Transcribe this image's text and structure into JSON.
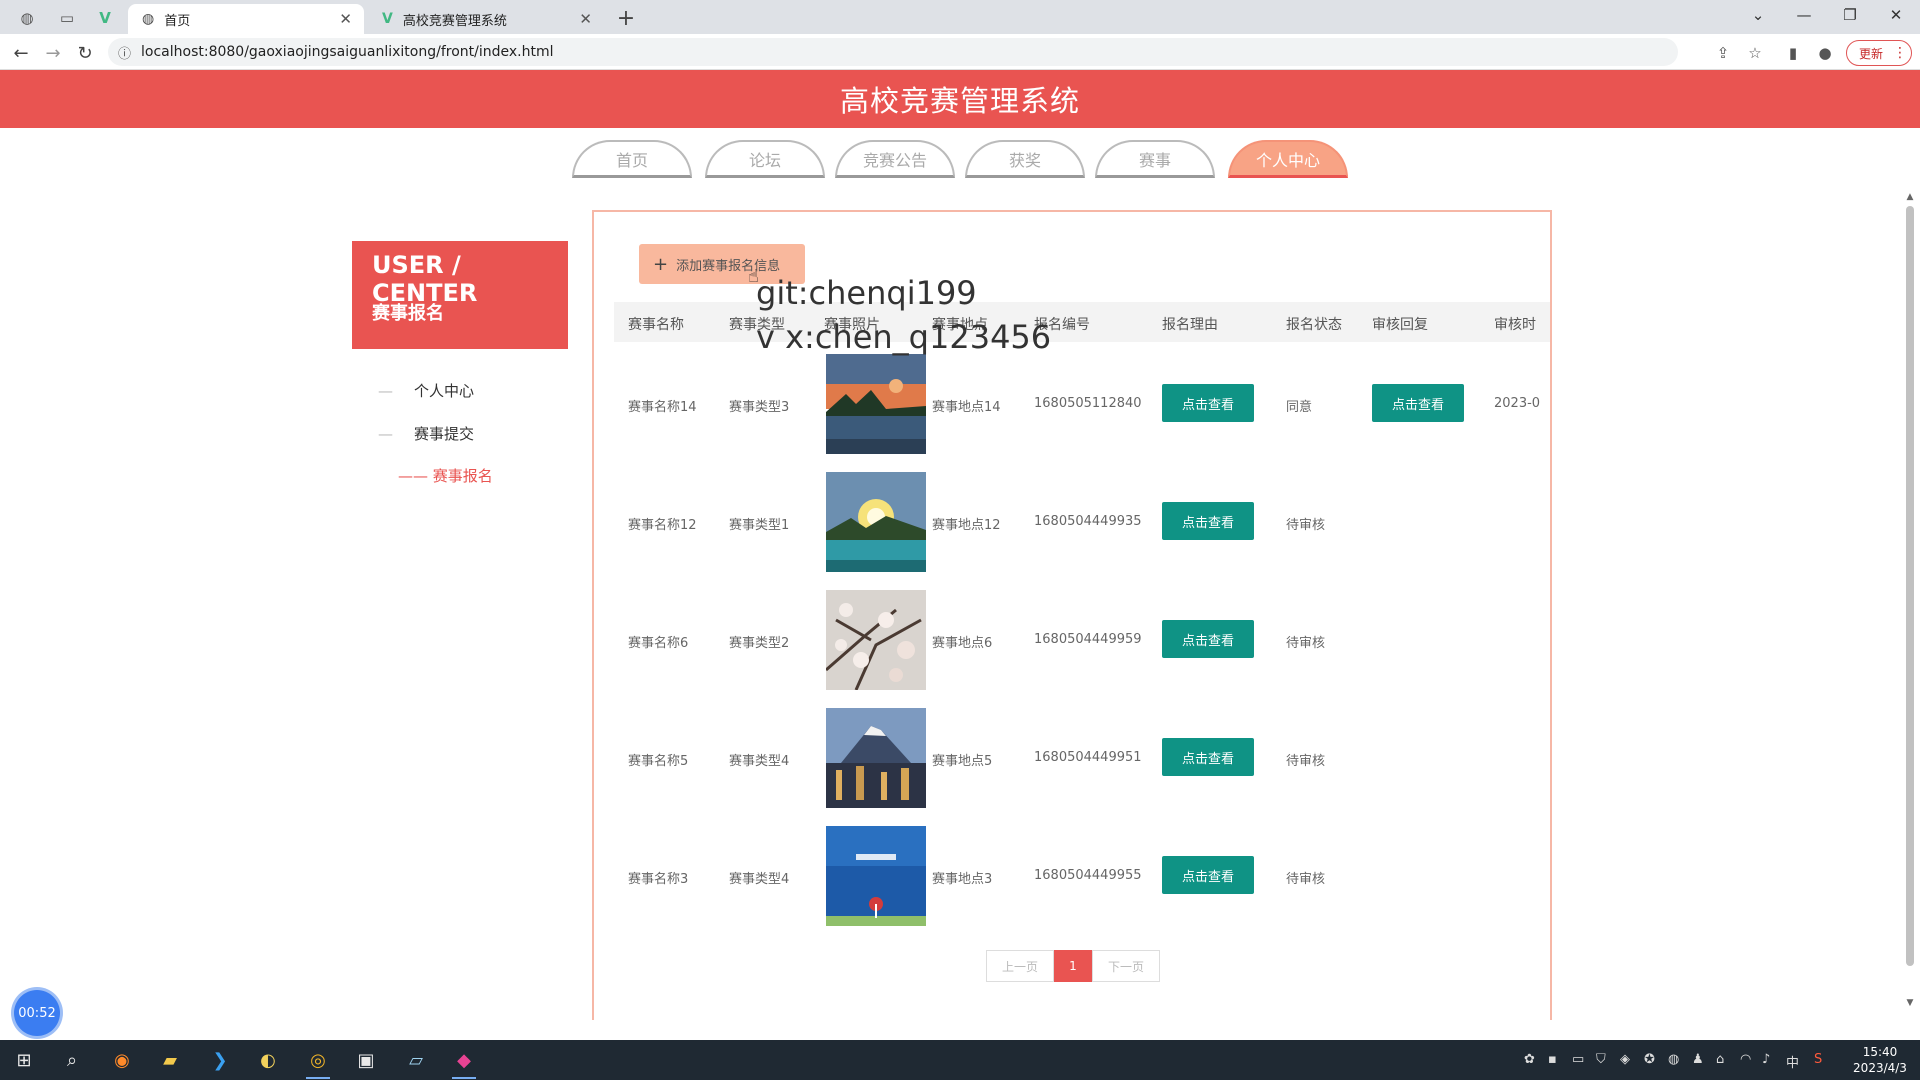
{
  "browser": {
    "tabs": [
      {
        "label": "首页",
        "icon": "globe-icon",
        "active": true
      },
      {
        "label": "高校竞赛管理系统",
        "icon": "vue-icon",
        "active": false
      }
    ],
    "new_tab": "+",
    "url": "localhost:8080/gaoxiaojingsaiguanlixitong/front/index.html",
    "update_label": "更新"
  },
  "site": {
    "title": "高校竞赛管理系统",
    "nav": [
      "首页",
      "论坛",
      "竞赛公告",
      "获奖",
      "赛事",
      "个人中心"
    ],
    "active_nav": "个人中心"
  },
  "sidebar": {
    "heading": "USER / CENTER",
    "subheading": "赛事报名",
    "items": [
      {
        "label": "个人中心"
      },
      {
        "label": "赛事提交"
      }
    ],
    "active_sub": "—— 赛事报名"
  },
  "main": {
    "add_button": "添加赛事报名信息",
    "columns": [
      "赛事名称",
      "赛事类型",
      "赛事照片",
      "赛事地点",
      "报名编号",
      "报名理由",
      "报名状态",
      "审核回复",
      "审核时"
    ],
    "view_label": "点击查看",
    "rows": [
      {
        "name": "赛事名称14",
        "type": "赛事类型3",
        "place": "赛事地点14",
        "code": "1680505112840",
        "status": "同意",
        "reply": "点击查看",
        "time": "2023-0"
      },
      {
        "name": "赛事名称12",
        "type": "赛事类型1",
        "place": "赛事地点12",
        "code": "1680504449935",
        "status": "待审核",
        "reply": "",
        "time": ""
      },
      {
        "name": "赛事名称6",
        "type": "赛事类型2",
        "place": "赛事地点6",
        "code": "1680504449959",
        "status": "待审核",
        "reply": "",
        "time": ""
      },
      {
        "name": "赛事名称5",
        "type": "赛事类型4",
        "place": "赛事地点5",
        "code": "1680504449951",
        "status": "待审核",
        "reply": "",
        "time": ""
      },
      {
        "name": "赛事名称3",
        "type": "赛事类型4",
        "place": "赛事地点3",
        "code": "1680504449955",
        "status": "待审核",
        "reply": "",
        "time": ""
      }
    ],
    "pager": {
      "prev": "上一页",
      "current": "1",
      "next": "下一页"
    }
  },
  "overlay": {
    "watermark_line1": "git:chenqi199",
    "watermark_line2": "v x:chen_q123456",
    "timer": "00:52"
  },
  "taskbar": {
    "ime": "中",
    "time": "15:40",
    "date": "2023/4/3"
  },
  "colors": {
    "brand_red": "#e95451",
    "teal_button": "#0f9385",
    "peach": "#f8a385"
  }
}
